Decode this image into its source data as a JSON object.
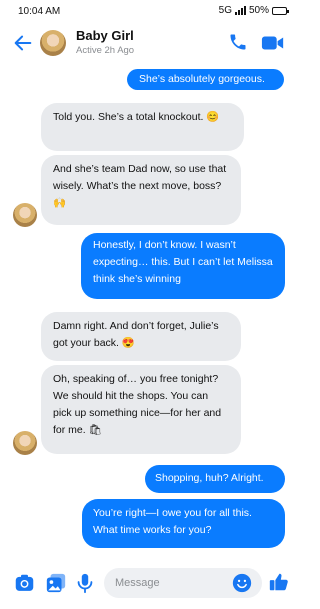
{
  "status_bar": {
    "time": "10:04 AM",
    "network": "5G",
    "battery": "50%",
    "battery_level": 0.5
  },
  "header": {
    "contact_name": "Baby Girl",
    "contact_status": "Active 2h Ago"
  },
  "messages": [
    {
      "from": "me",
      "text": "She’s absolutely gorgeous."
    },
    {
      "from": "them",
      "text": "Told you. She’s a total knockout. 😊"
    },
    {
      "from": "them",
      "text": "And she’s team Dad now, so use that wisely. What’s the next move, boss? 🙌"
    },
    {
      "from": "me",
      "text": "Honestly, I don’t know. I wasn’t expecting… this. But I can’t let Melissa think she’s winning"
    },
    {
      "from": "them",
      "text": "Damn right. And don’t forget, Julie’s got your back. 😍"
    },
    {
      "from": "them",
      "text": "Oh, speaking of… you free tonight? We should hit the shops. You can pick up something nice—for her and for me. 🛍"
    },
    {
      "from": "me",
      "text": "Shopping, huh? Alright."
    },
    {
      "from": "me",
      "text": "You’re right—I owe you for all this. What time works for you?"
    }
  ],
  "composer": {
    "placeholder": "Message"
  },
  "icons": {
    "back": "back-arrow-icon",
    "call": "phone-icon",
    "video": "video-camera-icon",
    "camera": "camera-icon",
    "gallery": "image-gallery-icon",
    "mic": "microphone-icon",
    "emoji": "smiley-emoji-icon",
    "like": "thumbs-up-icon"
  },
  "colors": {
    "accent": "#1877f2",
    "outgoing_bubble": "#0a7cff",
    "incoming_bubble": "#e8eaed",
    "emoji_button": "#f5c518"
  }
}
